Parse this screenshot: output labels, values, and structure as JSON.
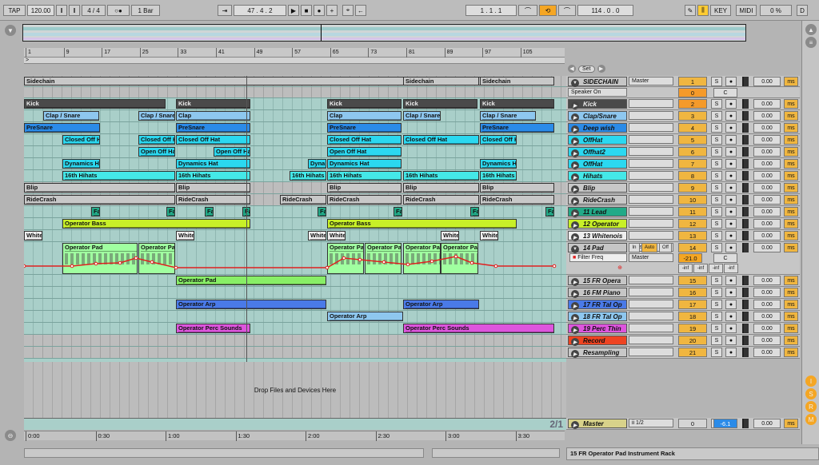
{
  "transport": {
    "tap": "TAP",
    "tempo": "120.00",
    "signature": "4 / 4",
    "metro": "○●",
    "quant": "1 Bar",
    "follow": "⇥",
    "position": "47 .  4 .  2",
    "loop_start": "1 .  1 .  1",
    "loop_len": "114 .  0 .  0",
    "key": "KEY",
    "midi": "MIDI",
    "cpu": "0 %",
    "disk": "D"
  },
  "bar_ticks": [
    "1",
    "9",
    "17",
    "25",
    "33",
    "41",
    "49",
    "57",
    "65",
    "73",
    "81",
    "89",
    "97",
    "105"
  ],
  "time_ticks": [
    "0:00",
    "0:30",
    "1:00",
    "1:30",
    "2:00",
    "2:30",
    "3:00",
    "3:30"
  ],
  "set_label": "Set",
  "drop_text": "Drop Files and Devices Here",
  "grid_label": "2/1",
  "status_text": "15 FR  Operator Pad Instrument Rack",
  "colors": {
    "cyan": "#2bc5e8",
    "blue": "#2b8be8",
    "lightblue": "#8ec7ef",
    "grey": "#bdbdbd",
    "green": "#44cc66",
    "lime": "#c8f028",
    "mint": "#a0ffa0",
    "purple": "#cc44cc",
    "orange": "#f5a623"
  },
  "lanes": [
    {
      "h": 14,
      "grey": true,
      "clips": [
        {
          "l": 0,
          "w": 663,
          "t": "Sidechain",
          "c": "#c8c8c8"
        },
        {
          "l": 474,
          "w": 95,
          "t": "Sidechain",
          "c": "#c8c8c8"
        },
        {
          "l": 570,
          "w": 93,
          "t": "Sidechain",
          "c": "#c8c8c8"
        }
      ]
    },
    {
      "h": 14,
      "grey": true,
      "clips": []
    },
    {
      "h": 15,
      "clips": [
        {
          "l": 0,
          "w": 177,
          "t": "Kick",
          "c": "#4a4a4a",
          "fg": "#eee"
        },
        {
          "l": 190,
          "w": 93,
          "t": "Kick",
          "c": "#4a4a4a",
          "fg": "#eee"
        },
        {
          "l": 379,
          "w": 93,
          "t": "Kick",
          "c": "#4a4a4a",
          "fg": "#eee"
        },
        {
          "l": 474,
          "w": 93,
          "t": "Kick",
          "c": "#4a4a4a",
          "fg": "#eee"
        },
        {
          "l": 570,
          "w": 93,
          "t": "Kick",
          "c": "#4a4a4a",
          "fg": "#eee"
        }
      ]
    },
    {
      "h": 15,
      "clips": [
        {
          "l": 24,
          "w": 70,
          "t": "Clap / Snare",
          "c": "#8ec7ef"
        },
        {
          "l": 143,
          "w": 46,
          "t": "Clap / Snare",
          "c": "#8ec7ef"
        },
        {
          "l": 190,
          "w": 93,
          "t": "Clap",
          "c": "#8ec7ef"
        },
        {
          "l": 379,
          "w": 93,
          "t": "Clap",
          "c": "#8ec7ef"
        },
        {
          "l": 474,
          "w": 47,
          "t": "Clap / Snare",
          "c": "#8ec7ef"
        },
        {
          "l": 570,
          "w": 70,
          "t": "Clap / Snare",
          "c": "#8ec7ef"
        }
      ]
    },
    {
      "h": 15,
      "clips": [
        {
          "l": 0,
          "w": 95,
          "t": "PreSnare",
          "c": "#2b8be8"
        },
        {
          "l": 190,
          "w": 93,
          "t": "PreSnare",
          "c": "#2b8be8"
        },
        {
          "l": 379,
          "w": 93,
          "t": "PreSnare",
          "c": "#2b8be8"
        },
        {
          "l": 570,
          "w": 93,
          "t": "PreSnare",
          "c": "#2b8be8"
        }
      ]
    },
    {
      "h": 15,
      "clips": [
        {
          "l": 48,
          "w": 47,
          "t": "Closed Off H",
          "c": "#2bd8f0"
        },
        {
          "l": 143,
          "w": 46,
          "t": "Closed Off H",
          "c": "#2bd8f0"
        },
        {
          "l": 190,
          "w": 93,
          "t": "Closed Off Hat",
          "c": "#2bd8f0"
        },
        {
          "l": 379,
          "w": 93,
          "t": "Closed Off Hat",
          "c": "#2bd8f0"
        },
        {
          "l": 474,
          "w": 95,
          "t": "Closed Off Hat",
          "c": "#2bd8f0"
        },
        {
          "l": 570,
          "w": 46,
          "t": "Closed Off H",
          "c": "#2bd8f0"
        }
      ]
    },
    {
      "h": 15,
      "clips": [
        {
          "l": 143,
          "w": 46,
          "t": "Open Off Ha",
          "c": "#2bd8f0"
        },
        {
          "l": 237,
          "w": 46,
          "t": "Open Off Ha",
          "c": "#2bd8f0"
        },
        {
          "l": 379,
          "w": 93,
          "t": "Open Off Hat",
          "c": "#2bd8f0"
        }
      ]
    },
    {
      "h": 15,
      "clips": [
        {
          "l": 48,
          "w": 47,
          "t": "Dynamics H",
          "c": "#2bd8f0"
        },
        {
          "l": 190,
          "w": 93,
          "t": "Dynamics Hat",
          "c": "#2bd8f0"
        },
        {
          "l": 355,
          "w": 23,
          "t": "Dyna",
          "c": "#2bd8f0"
        },
        {
          "l": 379,
          "w": 93,
          "t": "Dynamics Hat",
          "c": "#2bd8f0"
        },
        {
          "l": 570,
          "w": 46,
          "t": "Dynamics H",
          "c": "#2bd8f0"
        }
      ]
    },
    {
      "h": 15,
      "clips": [
        {
          "l": 48,
          "w": 141,
          "t": "16th Hihats",
          "c": "#44e8e8"
        },
        {
          "l": 190,
          "w": 93,
          "t": "16th Hihats",
          "c": "#44e8e8"
        },
        {
          "l": 332,
          "w": 46,
          "t": "16th Hihats",
          "c": "#44e8e8"
        },
        {
          "l": 379,
          "w": 93,
          "t": "16th Hihats",
          "c": "#44e8e8"
        },
        {
          "l": 474,
          "w": 95,
          "t": "16th Hihats",
          "c": "#44e8e8"
        },
        {
          "l": 570,
          "w": 46,
          "t": "16th Hihats",
          "c": "#44e8e8"
        }
      ]
    },
    {
      "h": 15,
      "grey": true,
      "clips": [
        {
          "l": 0,
          "w": 189,
          "t": "Blip",
          "c": "#c8c8c8"
        },
        {
          "l": 190,
          "w": 93,
          "t": "Blip",
          "c": "#c8c8c8"
        },
        {
          "l": 379,
          "w": 93,
          "t": "Blip",
          "c": "#c8c8c8"
        },
        {
          "l": 474,
          "w": 95,
          "t": "Blip",
          "c": "#c8c8c8"
        },
        {
          "l": 570,
          "w": 93,
          "t": "Blip",
          "c": "#c8c8c8"
        }
      ]
    },
    {
      "h": 15,
      "grey": true,
      "clips": [
        {
          "l": 0,
          "w": 189,
          "t": "RideCrash",
          "c": "#c8c8c8"
        },
        {
          "l": 190,
          "w": 93,
          "t": "RideCrash",
          "c": "#c8c8c8"
        },
        {
          "l": 320,
          "w": 58,
          "t": "RideCrash",
          "c": "#c8c8c8"
        },
        {
          "l": 379,
          "w": 93,
          "t": "RideCrash",
          "c": "#c8c8c8"
        },
        {
          "l": 474,
          "w": 95,
          "t": "RideCrash",
          "c": "#c8c8c8"
        },
        {
          "l": 570,
          "w": 93,
          "t": "RideCrash",
          "c": "#c8c8c8"
        }
      ]
    },
    {
      "h": 15,
      "clips": [
        {
          "l": 84,
          "w": 11,
          "t": "Fa",
          "c": "#22aa88"
        },
        {
          "l": 178,
          "w": 11,
          "t": "Fa",
          "c": "#22aa88"
        },
        {
          "l": 226,
          "w": 11,
          "t": "Fa",
          "c": "#22aa88"
        },
        {
          "l": 273,
          "w": 10,
          "t": "Fa",
          "c": "#22aa88"
        },
        {
          "l": 367,
          "w": 11,
          "t": "Fa",
          "c": "#22aa88"
        },
        {
          "l": 462,
          "w": 11,
          "t": "Fa",
          "c": "#22aa88"
        },
        {
          "l": 558,
          "w": 11,
          "t": "Fa",
          "c": "#22aa88"
        },
        {
          "l": 652,
          "w": 11,
          "t": "Fa",
          "c": "#22aa88"
        }
      ]
    },
    {
      "h": 15,
      "clips": [
        {
          "l": 48,
          "w": 235,
          "t": "Operator Bass",
          "c": "#c8f028"
        },
        {
          "l": 379,
          "w": 237,
          "t": "Operator Bass",
          "c": "#c8f028"
        }
      ]
    },
    {
      "h": 15,
      "clips": [
        {
          "l": 0,
          "w": 23,
          "t": "White",
          "c": "#eeeeee"
        },
        {
          "l": 190,
          "w": 23,
          "t": "White",
          "c": "#eeeeee"
        },
        {
          "l": 355,
          "w": 23,
          "t": "White",
          "c": "#eeeeee"
        },
        {
          "l": 379,
          "w": 23,
          "t": "White",
          "c": "#eeeeee"
        },
        {
          "l": 521,
          "w": 23,
          "t": "White",
          "c": "#eeeeee"
        },
        {
          "l": 570,
          "w": 23,
          "t": "White",
          "c": "#eeeeee"
        }
      ]
    },
    {
      "h": 41,
      "clips": [
        {
          "l": 48,
          "w": 94,
          "t": "Operator Pad",
          "c": "#a0ffa0",
          "tall": true
        },
        {
          "l": 143,
          "w": 46,
          "t": "Operator Pa",
          "c": "#a0ffa0",
          "tall": true
        },
        {
          "l": 379,
          "w": 46,
          "t": "Operator Pa",
          "c": "#a0ffa0",
          "tall": true
        },
        {
          "l": 426,
          "w": 46,
          "t": "Operator Pa",
          "c": "#a0ffa0",
          "tall": true
        },
        {
          "l": 474,
          "w": 47,
          "t": "Operator Pa",
          "c": "#a0ffa0",
          "tall": true
        },
        {
          "l": 521,
          "w": 47,
          "t": "Operator Pa",
          "c": "#a0ffa0",
          "tall": true
        }
      ],
      "envelope": true
    },
    {
      "h": 15,
      "clips": [
        {
          "l": 190,
          "w": 188,
          "t": "Operator Pad",
          "c": "#88ee66"
        }
      ]
    },
    {
      "h": 15,
      "clips": []
    },
    {
      "h": 15,
      "clips": [
        {
          "l": 190,
          "w": 188,
          "t": "Operator Arp",
          "c": "#4a7ae8"
        },
        {
          "l": 474,
          "w": 95,
          "t": "Operator Arp",
          "c": "#4a7ae8"
        }
      ]
    },
    {
      "h": 15,
      "clips": [
        {
          "l": 379,
          "w": 95,
          "t": "Operator Arp",
          "c": "#8ec7ef"
        }
      ]
    },
    {
      "h": 15,
      "clips": [
        {
          "l": 190,
          "w": 93,
          "t": "Operator Perc Sounds",
          "c": "#dd55dd"
        },
        {
          "l": 474,
          "w": 189,
          "t": "Operator Perc Sounds",
          "c": "#dd55dd"
        }
      ]
    },
    {
      "h": 15,
      "grey": true,
      "clips": []
    },
    {
      "h": 15,
      "grey": true,
      "clips": []
    }
  ],
  "tracks": [
    {
      "name": "SIDECHAIN",
      "h": 14,
      "color": "#c6c6c6",
      "route": "Master",
      "num": "1",
      "vol": "0.00",
      "open": true
    },
    {
      "name": "",
      "h": 14,
      "color": "#c6c6c6",
      "route": "Speaker On",
      "num": "0",
      "vol": "",
      "sub": true
    },
    {
      "name": "Kick",
      "h": 15,
      "color": "#4a4a4a",
      "fg": "#eee",
      "route": "",
      "num": "2",
      "vol": "0.00"
    },
    {
      "name": "Clap/Snare",
      "h": 15,
      "color": "#8ec7ef",
      "route": "",
      "num": "3",
      "vol": "0.00"
    },
    {
      "name": "Deep wish",
      "h": 15,
      "color": "#2b8be8",
      "route": "",
      "num": "4",
      "vol": "0.00"
    },
    {
      "name": "OffHat",
      "h": 15,
      "color": "#2bd8f0",
      "route": "",
      "num": "5",
      "vol": "0.00"
    },
    {
      "name": "Offhat2",
      "h": 15,
      "color": "#2bd8f0",
      "route": "",
      "num": "6",
      "vol": "0.00"
    },
    {
      "name": "OffHat",
      "h": 15,
      "color": "#2bd8f0",
      "route": "",
      "num": "7",
      "vol": "0.00"
    },
    {
      "name": "Hihats",
      "h": 15,
      "color": "#44e8e8",
      "route": "",
      "num": "8",
      "vol": "0.00"
    },
    {
      "name": "Blip",
      "h": 15,
      "color": "#c8c8c8",
      "route": "",
      "num": "9",
      "vol": "0.00"
    },
    {
      "name": "RideCrash",
      "h": 15,
      "color": "#c8c8c8",
      "route": "",
      "num": "10",
      "vol": "0.00"
    },
    {
      "name": "11 Lead",
      "h": 15,
      "color": "#22aa88",
      "route": "",
      "num": "11",
      "vol": "0.00"
    },
    {
      "name": "12 Operator",
      "h": 15,
      "color": "#c8f028",
      "route": "",
      "num": "12",
      "vol": "0.00"
    },
    {
      "name": "13 Whitenois",
      "h": 15,
      "color": "#eeeeee",
      "route": "",
      "num": "13",
      "vol": "0.00"
    },
    {
      "name": "14 Pad",
      "h": 41,
      "color": "#c6c6c6",
      "route": "Master",
      "num": "14",
      "vol": "0.00",
      "pad": true,
      "param": "Filter Freq",
      "pval": "-21.0",
      "inf": [
        "-inf",
        "-inf",
        "-inf",
        "-inf"
      ]
    },
    {
      "name": "15 FR  Opera",
      "h": 15,
      "color": "#c6c6c6",
      "route": "",
      "num": "15",
      "vol": "0.00"
    },
    {
      "name": "16 FM Piano",
      "h": 15,
      "color": "#c6c6c6",
      "route": "",
      "num": "16",
      "vol": "0.00"
    },
    {
      "name": "17 FR Tal Op",
      "h": 15,
      "color": "#4a7ae8",
      "route": "",
      "num": "17",
      "vol": "0.00"
    },
    {
      "name": "18 FR Tal Op",
      "h": 15,
      "color": "#8ec7ef",
      "route": "",
      "num": "18",
      "vol": "0.00"
    },
    {
      "name": "19 Perc Thin",
      "h": 15,
      "color": "#dd55dd",
      "route": "",
      "num": "19",
      "vol": "0.00"
    },
    {
      "name": "Record",
      "h": 15,
      "color": "#ee4422",
      "route": "",
      "num": "20",
      "vol": "0.00"
    },
    {
      "name": "Resampling",
      "h": 15,
      "color": "#c8c8c8",
      "route": "",
      "num": "21",
      "vol": "0.00"
    }
  ],
  "master": {
    "name": "Master",
    "route": "ii 1/2",
    "num": "0",
    "vol": "-6.1",
    "vol2": "0.00"
  },
  "auto_labels": {
    "in": "In",
    "auto": "Auto",
    "off": "Off",
    "c": "C",
    "s": "S",
    "ms": "ms"
  }
}
